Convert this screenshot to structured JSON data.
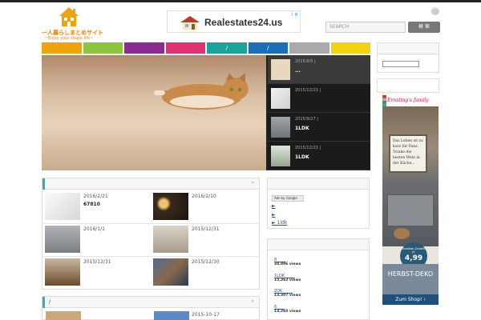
{
  "site": {
    "logo_title": "一人暮らしまとめサイト",
    "logo_sub": "~Enjoy your single life~"
  },
  "ad": {
    "text": "Realestates24.us",
    "badge": "i ✕"
  },
  "search": {
    "placeholder": "SEARCH",
    "button": "検 索"
  },
  "nav": {
    "items": [
      {
        "label": "",
        "color": "#f0a30a"
      },
      {
        "label": "",
        "color": "#8cc63f"
      },
      {
        "label": "",
        "color": "#8e2b8f"
      },
      {
        "label": "",
        "color": "#e0306f"
      },
      {
        "label": "/",
        "color": "#1aa39a"
      },
      {
        "label": "/",
        "color": "#1b6fb9"
      },
      {
        "label": "",
        "color": "#aaaaaa"
      },
      {
        "label": "",
        "color": "#f2d411"
      }
    ]
  },
  "slider": {
    "items": [
      {
        "date": "2015/9/5  |",
        "title": "...",
        "active": true
      },
      {
        "date": "2015/12/23  |",
        "title": "",
        "active": false
      },
      {
        "date": "2015/9/27  |",
        "title": "1LDK",
        "active": false
      },
      {
        "date": "2015/12/23  |",
        "title": "1LDK",
        "active": false
      }
    ]
  },
  "posts_panel": {
    "arrow": "»",
    "posts": [
      {
        "date": "2016/2/21",
        "title": "67810"
      },
      {
        "date": "2016/2/10",
        "title": ""
      },
      {
        "date": "2016/1/1",
        "title": ""
      },
      {
        "date": "2015/12/31",
        "title": ""
      },
      {
        "date": "2015/12/31",
        "title": ""
      },
      {
        "date": "2015/12/30",
        "title": ""
      }
    ]
  },
  "second_panel": {
    "title": "/",
    "arrow": "»",
    "date": "2015-10-17"
  },
  "sidebar": {
    "ads_google": "Ads by Google",
    "links": [
      "►",
      "►",
      "► 1ldk"
    ],
    "ranking": [
      {
        "title": "8       ",
        "views": "34,896 views"
      },
      {
        "title": "1LDK        ",
        "views": "15,362 views"
      },
      {
        "title": "2DK        ",
        "views": "13,307 views"
      },
      {
        "title": "6      ",
        "views": "13,260 views"
      }
    ]
  },
  "banner": {
    "brand": "Ernsting's family",
    "sign_text": "Das Leben ist zu kurz für Panz. Trinke die besten Wein in der Küche...",
    "price_label": "Porzellan-Schalen je",
    "price": "4,99",
    "deko": "HERBST-DEKO",
    "shop": "Zum Shop! ›"
  },
  "colors": {
    "accent": "#2bb5a5",
    "link": "#2255aa"
  }
}
